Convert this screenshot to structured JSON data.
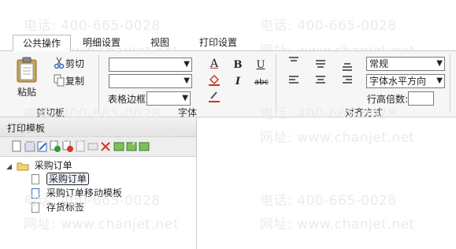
{
  "watermark": {
    "phone": "电话: 400-665-0028",
    "site": "网址: www.chanjet.net"
  },
  "tabs": [
    {
      "label": "公共操作",
      "active": true
    },
    {
      "label": "明细设置",
      "active": false
    },
    {
      "label": "视图",
      "active": false
    },
    {
      "label": "打印设置",
      "active": false
    }
  ],
  "ribbon": {
    "clipboard": {
      "paste_label": "粘贴",
      "cut_label": "剪切",
      "copy_label": "复制",
      "group_label": "剪切板"
    },
    "font": {
      "font_family_value": "",
      "font_size_value": "",
      "table_border_label": "表格边框",
      "table_border_value": "",
      "group_label": "字体",
      "font_color_icon_letter": "A",
      "bold_icon_letter": "B",
      "underline_icon_letter": "U",
      "italic_icon_letter": "I",
      "strike_icon_text": "abc"
    },
    "align": {
      "style_value": "常规",
      "h_align_value": "字体水平方向",
      "row_height_label": "行高倍数:",
      "row_height_value": "",
      "group_label": "对齐方式"
    }
  },
  "panel": {
    "title": "打印模板",
    "tree": {
      "root": "采购订单",
      "children": [
        "采购订单",
        "采购订单移动模板",
        "存货标签"
      ],
      "selected_index": 0
    }
  }
}
